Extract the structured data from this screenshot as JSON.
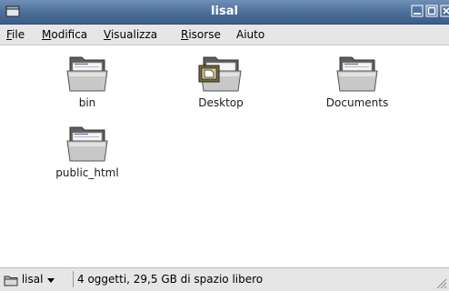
{
  "window": {
    "title": "lisal"
  },
  "menubar": {
    "items": [
      {
        "label": "File",
        "mnemonic": "F",
        "rest": "ile"
      },
      {
        "label": "Modifica",
        "mnemonic": "M",
        "rest": "odifica"
      },
      {
        "label": "Visualizza",
        "mnemonic": "V",
        "rest": "isualizza"
      },
      {
        "label": "Risorse",
        "mnemonic": "R",
        "rest": "isorse"
      },
      {
        "label": "Aiuto",
        "mnemonic": "",
        "rest": "Aiuto"
      }
    ]
  },
  "files": [
    {
      "name": "bin",
      "icon": "folder-icon"
    },
    {
      "name": "Desktop",
      "icon": "desktop-folder-icon"
    },
    {
      "name": "Documents",
      "icon": "folder-icon"
    },
    {
      "name": "public_html",
      "icon": "folder-icon"
    }
  ],
  "statusbar": {
    "location": "lisal",
    "info": "4 oggetti, 29,5 GB di spazio libero"
  },
  "colors": {
    "titlebar": "#4b6d99",
    "menubar": "#e6e6e6"
  }
}
